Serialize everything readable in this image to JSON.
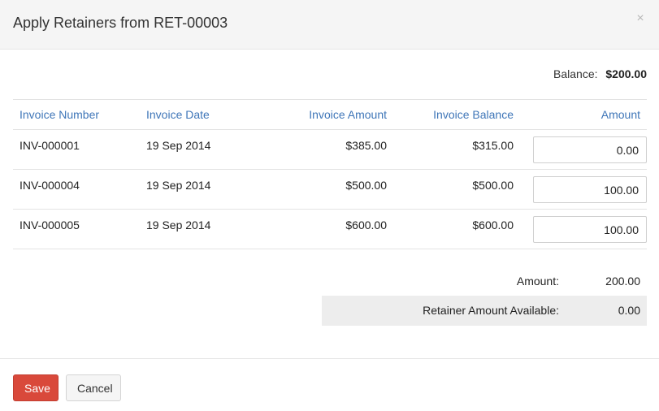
{
  "dialog": {
    "title": "Apply Retainers from RET-00003",
    "close_icon": "×"
  },
  "balance": {
    "label": "Balance:",
    "value": "$200.00"
  },
  "table": {
    "headers": {
      "invoice_number": "Invoice Number",
      "invoice_date": "Invoice Date",
      "invoice_amount": "Invoice Amount",
      "invoice_balance": "Invoice Balance",
      "amount": "Amount"
    },
    "rows": [
      {
        "invoice_number": "INV-000001",
        "invoice_date": "19 Sep 2014",
        "invoice_amount": "$385.00",
        "invoice_balance": "$315.00",
        "amount": "0.00"
      },
      {
        "invoice_number": "INV-000004",
        "invoice_date": "19 Sep 2014",
        "invoice_amount": "$500.00",
        "invoice_balance": "$500.00",
        "amount": "100.00"
      },
      {
        "invoice_number": "INV-000005",
        "invoice_date": "19 Sep 2014",
        "invoice_amount": "$600.00",
        "invoice_balance": "$600.00",
        "amount": "100.00"
      }
    ]
  },
  "summary": {
    "amount_label": "Amount:",
    "amount_value": "200.00",
    "available_label": "Retainer Amount Available:",
    "available_value": "0.00"
  },
  "footer": {
    "save_label": "Save",
    "cancel_label": "Cancel"
  },
  "colors": {
    "header_text": "#3f76b8",
    "save_button": "#d9493b",
    "header_bg": "#f5f5f5",
    "summary_bg": "#ededed"
  }
}
